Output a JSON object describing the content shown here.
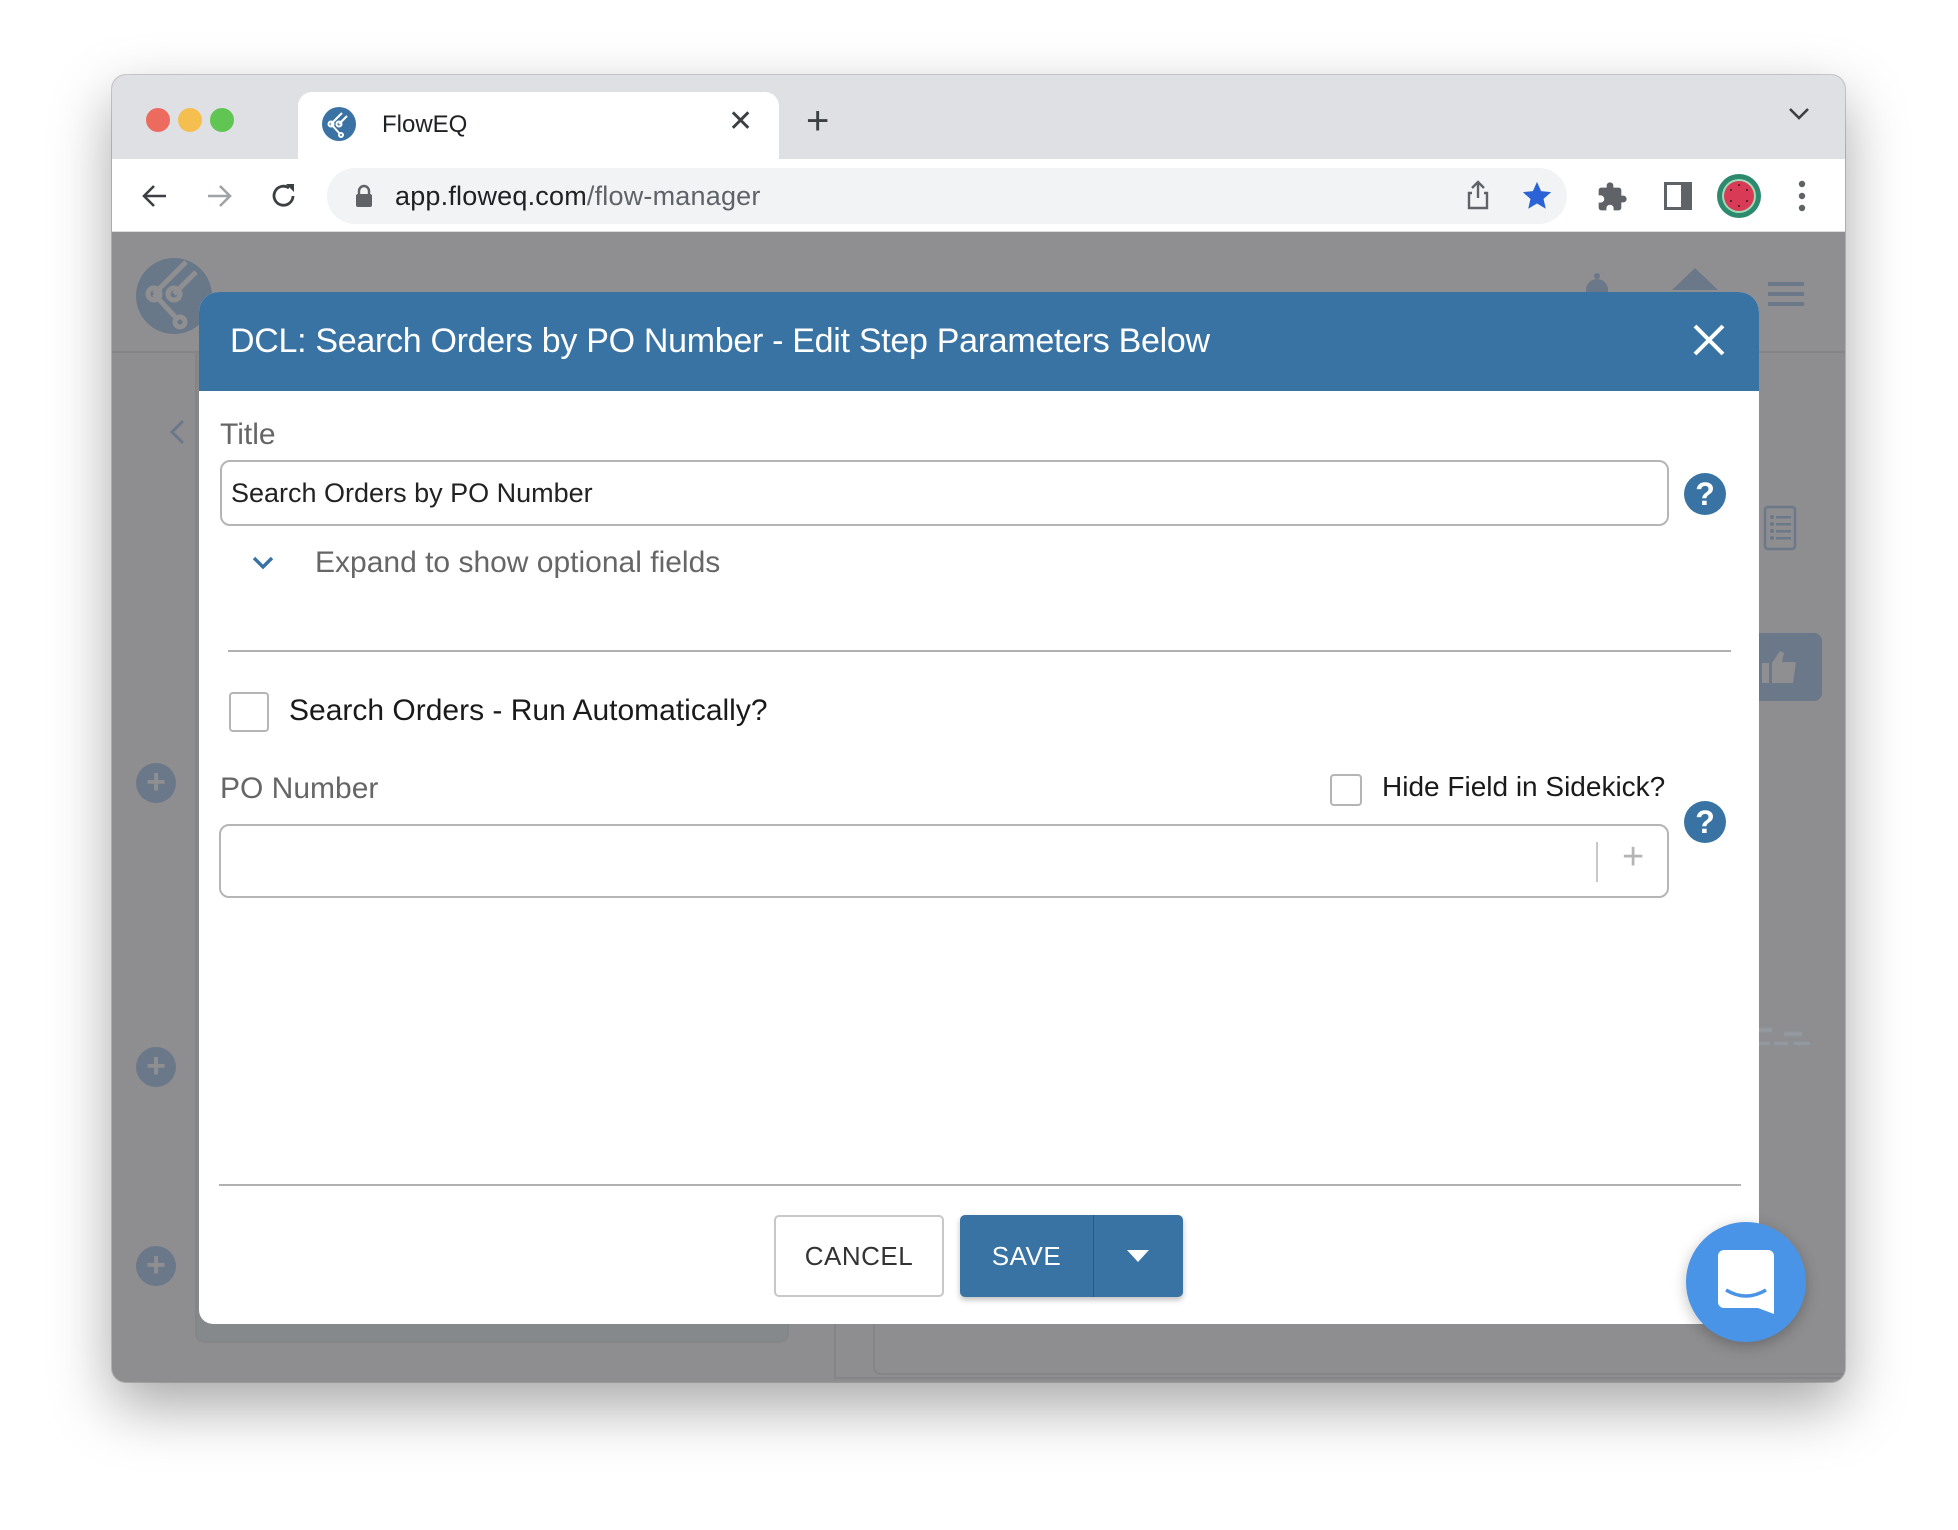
{
  "browser": {
    "tab_title": "FlowEQ",
    "tab_close_icon": "close-icon",
    "new_tab_icon": "plus-icon",
    "url_domain": "app.floweq.com",
    "url_path": "/flow-manager",
    "icons": [
      "back-arrow-icon",
      "forward-arrow-icon",
      "reload-icon",
      "lock-icon",
      "share-icon",
      "star-icon",
      "extensions-icon",
      "side-panel-icon",
      "profile-avatar",
      "more-vert-icon"
    ],
    "colors": {
      "star": "#2b63d6"
    }
  },
  "app": {
    "logo": "floweq-logo",
    "header_icons": [
      "bell-icon",
      "home-icon",
      "hamburger-menu-icon"
    ],
    "side_icons": [
      "chevron-left-icon",
      "list-icon",
      "thumbs-up-icon"
    ],
    "add_step_icon": "+"
  },
  "modal": {
    "title": "DCL: Search Orders by PO Number - Edit Step Parameters Below",
    "accent": "#3873a3",
    "title_field": {
      "label": "Title",
      "value": "Search Orders by PO Number",
      "help": "?"
    },
    "expand_label": "Expand to show optional fields",
    "run_auto": {
      "label": "Search Orders - Run Automatically?",
      "checked": false
    },
    "po_field": {
      "label": "PO Number",
      "value": "",
      "hide_label": "Hide Field in Sidekick?",
      "hide_checked": false,
      "add_symbol": "+",
      "help": "?"
    },
    "buttons": {
      "cancel": "CANCEL",
      "save": "SAVE"
    }
  },
  "chat_widget": {
    "icon": "chat-bubble-icon",
    "color": "#4a94e8"
  }
}
